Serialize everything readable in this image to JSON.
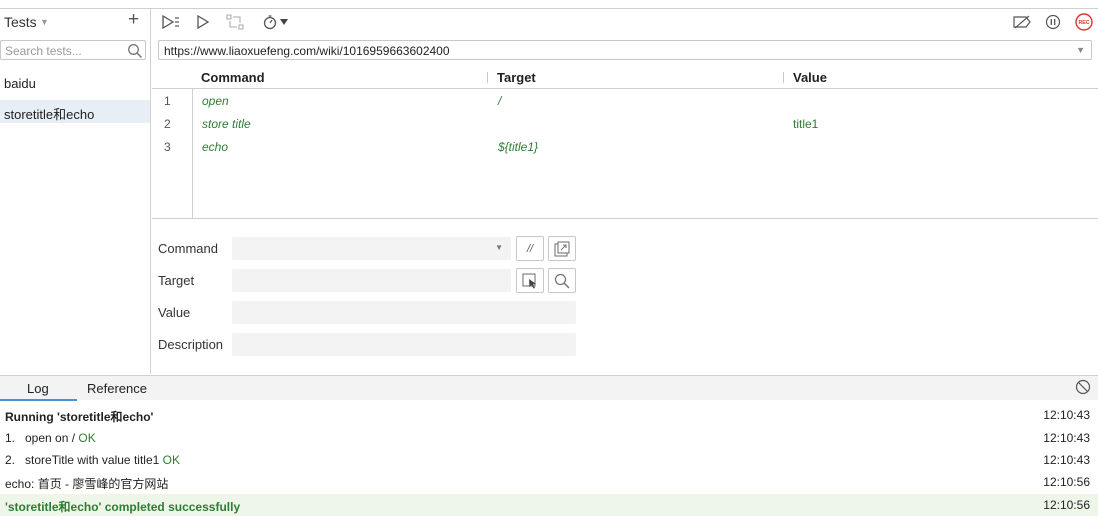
{
  "sidebar": {
    "title": "Tests",
    "search_placeholder": "Search tests...",
    "tests": [
      "baidu",
      "storetitle和echo"
    ],
    "selected_index": 1
  },
  "toolbar": {
    "left_icons": [
      "run-all-icon",
      "run-current-icon",
      "step-over-icon",
      "speed-timer-icon"
    ],
    "right_icons": [
      "disable-breakpoints-icon",
      "pause-icon",
      "record-icon"
    ],
    "record_label": "REC"
  },
  "url": "https://www.liaoxuefeng.com/wiki/1016959663602400",
  "table": {
    "headers": {
      "command": "Command",
      "target": "Target",
      "value": "Value"
    },
    "rows": [
      {
        "num": "1",
        "command": "open",
        "target": "/",
        "value": ""
      },
      {
        "num": "2",
        "command": "store title",
        "target": "",
        "value": "title1"
      },
      {
        "num": "3",
        "command": "echo",
        "target": "${title1}",
        "value": ""
      }
    ]
  },
  "editor": {
    "command_label": "Command",
    "target_label": "Target",
    "value_label": "Value",
    "description_label": "Description",
    "comment_button": "//"
  },
  "log": {
    "tabs": [
      "Log",
      "Reference"
    ],
    "active_tab": "Log",
    "entries": [
      {
        "text": "Running 'storetitle和echo'",
        "time": "12:10:43",
        "style": "bold"
      },
      {
        "text": "1.   open on / ",
        "ok": "OK",
        "time": "12:10:43",
        "style": "normal"
      },
      {
        "text": "2.   storeTitle with value title1 ",
        "ok": "OK",
        "time": "12:10:43",
        "style": "normal"
      },
      {
        "text": "echo: 首页 - 廖雪峰的官方网站",
        "time": "12:10:56",
        "style": "normal"
      },
      {
        "text": "'storetitle和echo' completed successfully",
        "time": "12:10:56",
        "style": "success"
      }
    ]
  },
  "colors": {
    "accent": "#4a8fd8",
    "ok_green": "#2e7d32",
    "record_red": "#d33",
    "selected_bg": "#e8eef5"
  }
}
